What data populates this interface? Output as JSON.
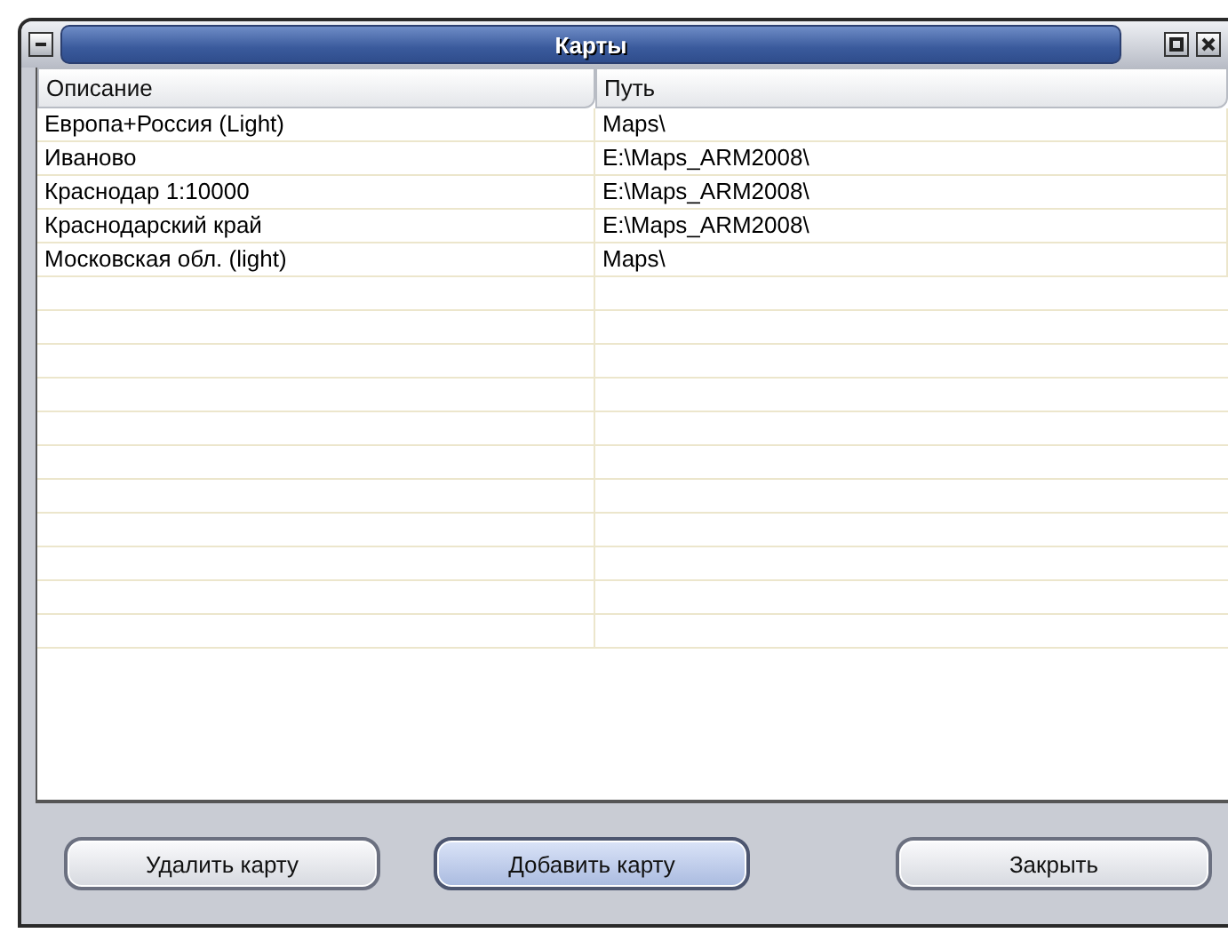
{
  "window": {
    "title": "Карты"
  },
  "table": {
    "columns": [
      "Описание",
      "Путь"
    ],
    "rows": [
      [
        "Европа+Россия (Light)",
        "Maps\\"
      ],
      [
        "Иваново",
        "E:\\Maps_ARM2008\\"
      ],
      [
        "Краснодар 1:10000",
        "E:\\Maps_ARM2008\\"
      ],
      [
        "Краснодарский край",
        "E:\\Maps_ARM2008\\"
      ],
      [
        "Московская обл. (light)",
        "Maps\\"
      ]
    ]
  },
  "buttons": [
    {
      "label": "Удалить карту",
      "focused": false
    },
    {
      "label": "Добавить карту",
      "focused": true
    },
    {
      "label": "Закрыть",
      "focused": false
    }
  ]
}
